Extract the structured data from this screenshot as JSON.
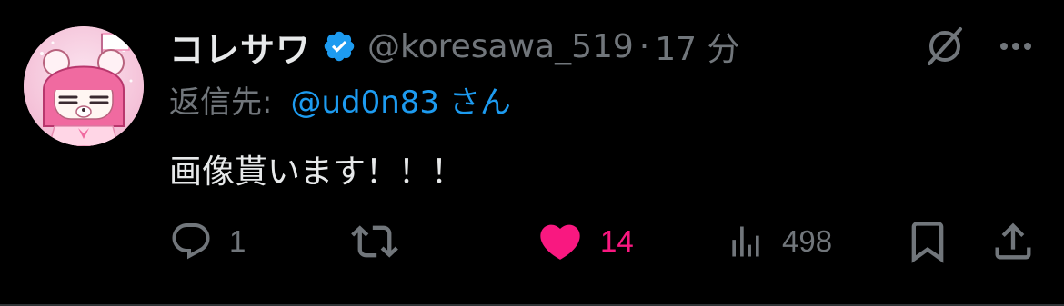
{
  "tweet": {
    "display_name": "コレサワ",
    "handle": "@koresawa_519",
    "separator": "·",
    "time": "17 分",
    "reply_prefix": "返信先:",
    "reply_target": "@ud0n83 さん",
    "text": "画像貰います！！！",
    "verified": true,
    "liked": true
  },
  "actions": {
    "reply": {
      "icon": "reply-icon",
      "count": "1"
    },
    "retweet": {
      "icon": "retweet-icon",
      "count": ""
    },
    "like": {
      "icon": "heart-icon",
      "count": "14"
    },
    "views": {
      "icon": "views-icon",
      "count": "498"
    },
    "bookmark": {
      "icon": "bookmark-icon"
    },
    "share": {
      "icon": "share-icon"
    }
  },
  "colors": {
    "background": "#000000",
    "text_primary": "#e7e9ea",
    "text_secondary": "#71767b",
    "accent_blue": "#1d9bf0",
    "like_pink": "#f91880",
    "verified_blue": "#1d9bf0"
  }
}
